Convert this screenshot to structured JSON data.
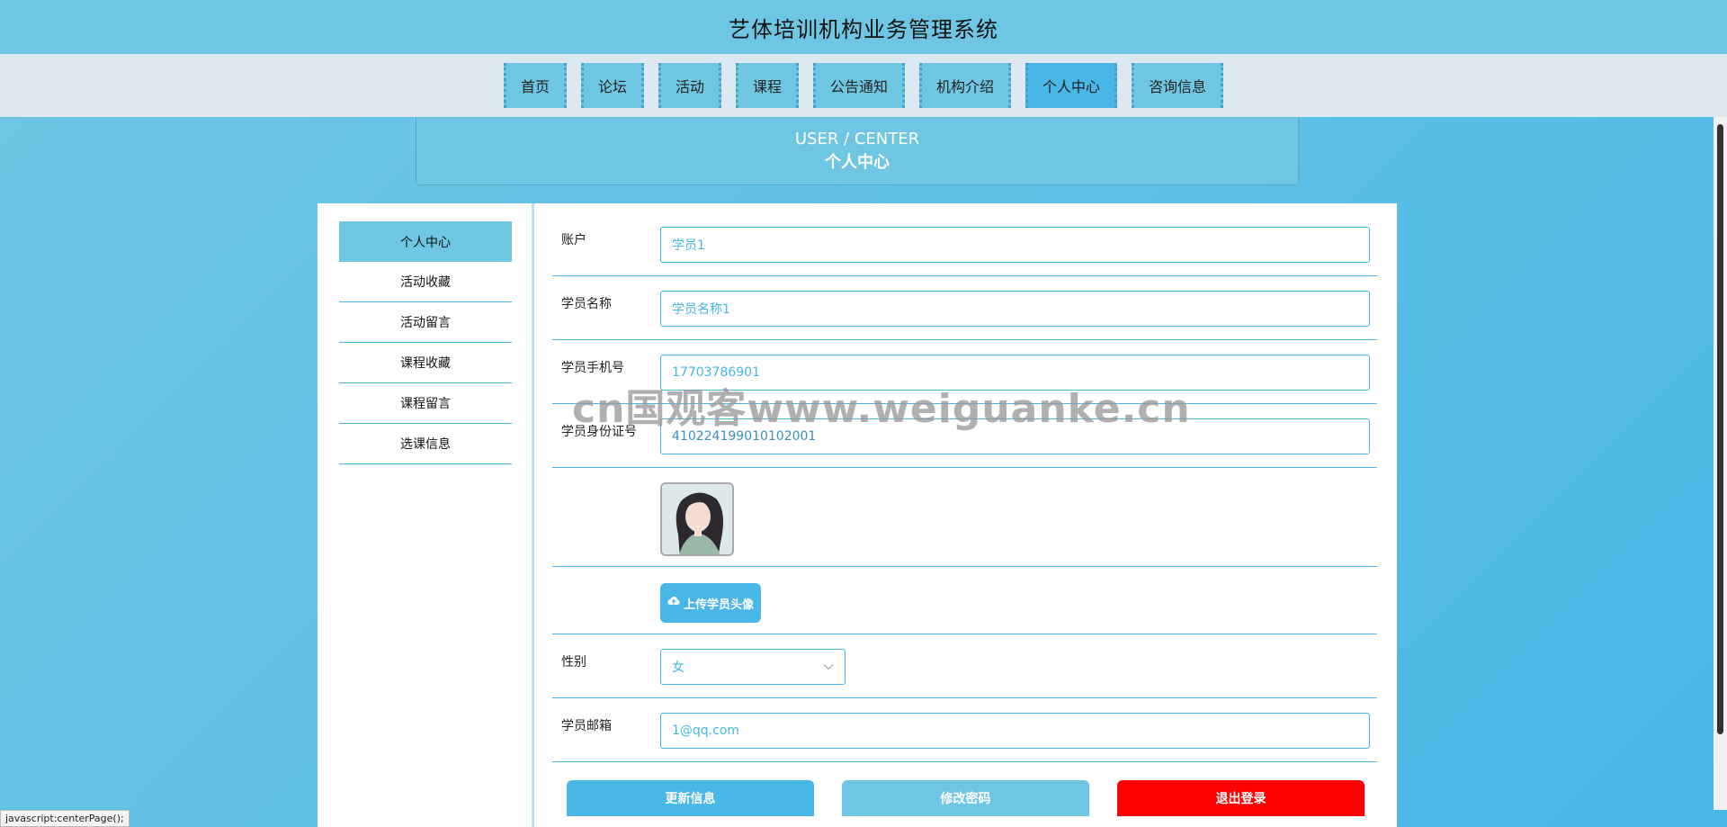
{
  "header": {
    "title": "艺体培训机构业务管理系统"
  },
  "nav": {
    "items": [
      {
        "label": "首页"
      },
      {
        "label": "论坛"
      },
      {
        "label": "活动"
      },
      {
        "label": "课程"
      },
      {
        "label": "公告通知"
      },
      {
        "label": "机构介绍"
      },
      {
        "label": "个人中心"
      },
      {
        "label": "咨询信息"
      }
    ],
    "active": "个人中心"
  },
  "banner": {
    "en": "USER / CENTER",
    "cn": "个人中心"
  },
  "sidebar": {
    "items": [
      {
        "label": "个人中心"
      },
      {
        "label": "活动收藏"
      },
      {
        "label": "活动留言"
      },
      {
        "label": "课程收藏"
      },
      {
        "label": "课程留言"
      },
      {
        "label": "选课信息"
      }
    ]
  },
  "form": {
    "account": {
      "label": "账户",
      "value": "学员1"
    },
    "name": {
      "label": "学员名称",
      "value": "学员名称1"
    },
    "phone": {
      "label": "学员手机号",
      "value": "17703786901"
    },
    "idcard": {
      "label": "学员身份证号",
      "value": "410224199010102001"
    },
    "upload_label": "上传学员头像",
    "gender": {
      "label": "性别",
      "value": "女"
    },
    "email": {
      "label": "学员邮箱",
      "value": "1@qq.com"
    }
  },
  "actions": {
    "update": "更新信息",
    "password": "修改密码",
    "logout": "退出登录"
  },
  "watermark": "cn国观客www.weiguanke.cn",
  "statusbar": "javascript:centerPage();",
  "colors": {
    "primary": "#48b6e6",
    "header": "#6fc6e3",
    "logout": "#ff0000",
    "password": "#6fc6e3"
  }
}
